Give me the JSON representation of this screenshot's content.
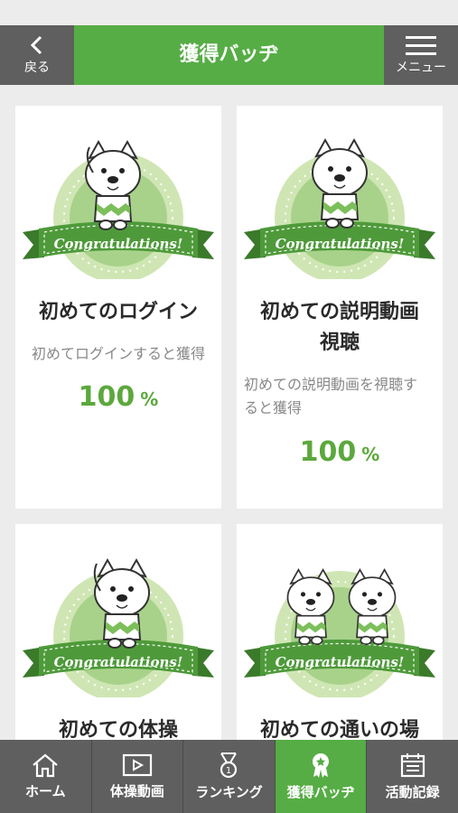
{
  "header": {
    "back_label": "戻る",
    "title": "獲得バッヂ",
    "menu_label": "メニュー"
  },
  "badge": {
    "ribbon_text": "Congratulations!",
    "colors": {
      "outer": "#cfe6b4",
      "inner": "#a8d28a",
      "ribbon": "#4e9a3a",
      "ribbon_dark": "#3a7a2a"
    }
  },
  "cards": [
    {
      "name": "初めてのログイン",
      "desc": "初めてログインすると獲得",
      "progress": "100",
      "unit": "%"
    },
    {
      "name": "初めての説明動画視聴",
      "name_line1": "初めての説明動画",
      "name_line2": "視聴",
      "desc_line1": "初めての説明動画を視聴す",
      "desc_line2": "ると獲得",
      "progress": "100",
      "unit": "%"
    },
    {
      "name": "初めての体操"
    },
    {
      "name": "初めての通いの場"
    }
  ],
  "tabs": [
    {
      "label": "ホーム",
      "icon": "home-icon"
    },
    {
      "label": "体操動画",
      "icon": "video-icon"
    },
    {
      "label": "ランキング",
      "icon": "medal-icon"
    },
    {
      "label": "獲得バッヂ",
      "icon": "badge-icon",
      "active": true
    },
    {
      "label": "活動記録",
      "icon": "calendar-icon"
    }
  ],
  "accent_color": "#56ad45"
}
